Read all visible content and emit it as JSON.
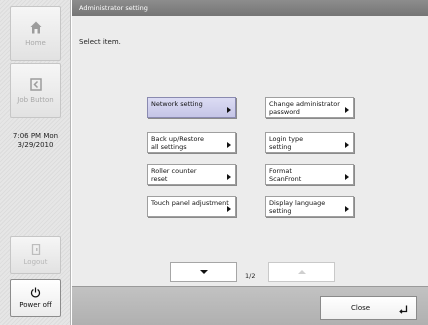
{
  "sidebar": {
    "home_label": "Home",
    "job_button_label": "Job Button",
    "clock_time": "7:06 PM  Mon",
    "clock_date": "3/29/2010",
    "logout_label": "Logout",
    "power_off_label": "Power off"
  },
  "header": {
    "title": "Administrator setting"
  },
  "main": {
    "prompt": "Select item.",
    "options": {
      "network": {
        "line1": "Network setting",
        "line2": ""
      },
      "change_admin_password": {
        "line1": "Change administrator",
        "line2": "password"
      },
      "backup_restore": {
        "line1": "Back up/Restore",
        "line2": "all settings"
      },
      "login_type": {
        "line1": "Login type",
        "line2": "setting"
      },
      "roller_counter": {
        "line1": "Roller counter",
        "line2": "reset"
      },
      "format_scanfront": {
        "line1": "Format",
        "line2": "ScanFront"
      },
      "touch_panel": {
        "line1": "Touch panel adjustment",
        "line2": ""
      },
      "display_language": {
        "line1": "Display language",
        "line2": "setting"
      }
    },
    "pager": {
      "page_label": "1/2",
      "current_page": 1,
      "total_pages": 2
    }
  },
  "footer": {
    "close_label": "Close"
  },
  "icons": {
    "home": "home-icon",
    "job_button": "job-button-icon",
    "logout": "logout-icon",
    "power": "power-icon",
    "next_page": "chevron-down-icon",
    "prev_page": "chevron-up-icon",
    "enter": "enter-icon",
    "option_arrow": "chevron-right-icon"
  },
  "colors": {
    "selected_option": "#c5c5e6",
    "title_bar": "#808080",
    "main_bg": "#ececec"
  }
}
